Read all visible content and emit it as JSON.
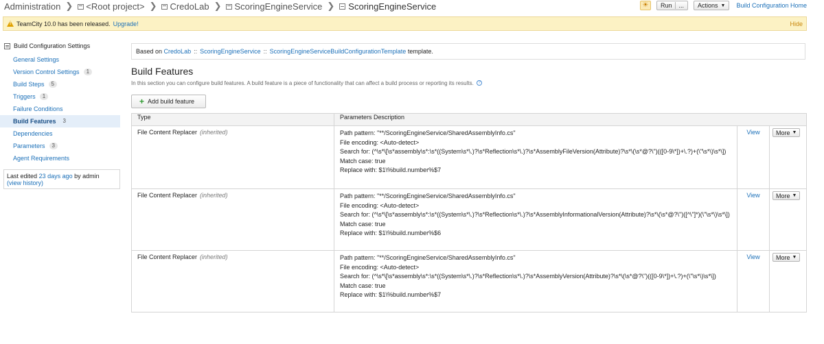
{
  "breadcrumbs": [
    {
      "label": "Administration",
      "icon": "none"
    },
    {
      "label": "<Root project>",
      "icon": "project-icon"
    },
    {
      "label": "CredoLab",
      "icon": "project-icon"
    },
    {
      "label": "ScoringEngineService",
      "icon": "project-icon"
    },
    {
      "label": "ScoringEngineService",
      "icon": "build-config-icon"
    }
  ],
  "toolbar": {
    "run_label": "Run",
    "run_more": "...",
    "actions_label": "Actions",
    "home_link": "Build Configuration Home"
  },
  "notice": {
    "text": "TeamCity 10.0 has been released.",
    "link": "Upgrade!",
    "hide": "Hide"
  },
  "sidebar": {
    "title": "Build Configuration Settings",
    "items": [
      {
        "label": "General Settings",
        "count": ""
      },
      {
        "label": "Version Control Settings",
        "count": "1"
      },
      {
        "label": "Build Steps",
        "count": "5"
      },
      {
        "label": "Triggers",
        "count": "1"
      },
      {
        "label": "Failure Conditions",
        "count": ""
      },
      {
        "label": "Build Features",
        "count": "3",
        "active": true
      },
      {
        "label": "Dependencies",
        "count": ""
      },
      {
        "label": "Parameters",
        "count": "3"
      },
      {
        "label": "Agent Requirements",
        "count": ""
      }
    ],
    "last_edited_prefix": "Last edited",
    "last_edited_when": "23 days ago",
    "last_edited_by": "by admin",
    "view_history": "(view history)"
  },
  "based_on": {
    "prefix": "Based on",
    "project": "CredoLab",
    "separator": "::",
    "subproject": "ScoringEngineService",
    "template": "ScoringEngineServiceBuildConfigurationTemplate",
    "suffix": "template."
  },
  "section": {
    "title": "Build Features",
    "description": "In this section you can configure build features. A build feature is a piece of functionality that can affect a build process or reporting its results.",
    "add_button": "Add build feature"
  },
  "table": {
    "headers": [
      "Type",
      "Parameters Description"
    ],
    "rows": [
      {
        "type": "File Content Replacer",
        "inherited": "(inherited)",
        "params": [
          "Path pattern: \"**/ScoringEngineService/SharedAssemblyInfo.cs\"",
          "File encoding: <Auto-detect>",
          "Search for: (^\\s*\\[\\s*assembly\\s*:\\s*((System\\s*\\.)?\\s*Reflection\\s*\\.)?\\s*AssemblyFileVersion(Attribute)?\\s*\\(\\s*@?\\\")(([0-9\\*])+\\.?)+(\\\"\\s*\\)\\s*\\])",
          "Match case: true",
          "Replace with: $1\\%build.number%$7"
        ],
        "view": "View",
        "more": "More"
      },
      {
        "type": "File Content Replacer",
        "inherited": "(inherited)",
        "params": [
          "Path pattern: \"**/ScoringEngineService/SharedAssemblyInfo.cs\"",
          "File encoding: <Auto-detect>",
          "Search for: (^\\s*\\[\\s*assembly\\s*:\\s*((System\\s*\\.)?\\s*Reflection\\s*\\.)?\\s*AssemblyInformationalVersion(Attribute)?\\s*\\(\\s*@?\\\")([^\\\"]*)(\\\"\\s*\\)\\s*\\])",
          "Match case: true",
          "Replace with: $1\\%build.number%$6"
        ],
        "view": "View",
        "more": "More"
      },
      {
        "type": "File Content Replacer",
        "inherited": "(inherited)",
        "params": [
          "Path pattern: \"**/ScoringEngineService/SharedAssemblyInfo.cs\"",
          "File encoding: <Auto-detect>",
          "Search for: (^\\s*\\[\\s*assembly\\s*:\\s*((System\\s*\\.)?\\s*Reflection\\s*\\.)?\\s*AssemblyVersion(Attribute)?\\s*\\(\\s*@?\\\")(([0-9\\*])+\\.?)+(\\\"\\s*\\)\\s*\\])",
          "Match case: true",
          "Replace with: $1\\%build.number%$7"
        ],
        "view": "View",
        "more": "More"
      }
    ]
  },
  "colors": {
    "link": "#1a6fb8",
    "notice_bg": "#fcf2c4",
    "active_bg": "#e4eef9",
    "add_plus": "#2f9a31"
  }
}
